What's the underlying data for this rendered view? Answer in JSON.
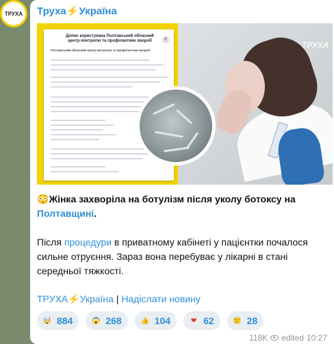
{
  "channel": {
    "avatar_text": "ТРУХА",
    "title": "Труха⚡Україна"
  },
  "media": {
    "watermark": "ТРУХА",
    "doc": {
      "title": "Допис користувача Полтавський обласний центр контролю та профілактики хвороб",
      "source": "Полтавський обласний центр контролю та профілактики хвороб"
    }
  },
  "post": {
    "headline_emoji": "😳",
    "headline_text": "Жінка захворіла на ботулізм після уколу ботоксу на ",
    "headline_link": "Полтавщині",
    "headline_end": ".",
    "body_before": "Після ",
    "body_link": "процедури",
    "body_after": " в приватному кабінеті у пацієнтки почалося сильне отруєння. Зараз вона перебуває у лікарні в стані середньої тяжкості.",
    "footer_channel": "ТРУХА⚡Україна",
    "footer_separator": " | ",
    "footer_send": "Надіслати новину"
  },
  "reactions": [
    {
      "icon": "shocked-face-icon",
      "glyph": "🤯",
      "count": "884",
      "color": "#f2b84a"
    },
    {
      "icon": "screaming-face-icon",
      "glyph": "😱",
      "count": "268",
      "color": "#8bb7e8"
    },
    {
      "icon": "thumbs-up-icon",
      "glyph": "👍",
      "count": "104",
      "color": "#f3bf4f"
    },
    {
      "icon": "heart-icon",
      "glyph": "❤",
      "count": "62",
      "color": "#e53935"
    },
    {
      "icon": "grimacing-face-icon",
      "glyph": "😕",
      "count": "28",
      "color": "#f2c44d"
    }
  ],
  "meta": {
    "views": "118K",
    "edited": "edited",
    "time": "10:27"
  }
}
